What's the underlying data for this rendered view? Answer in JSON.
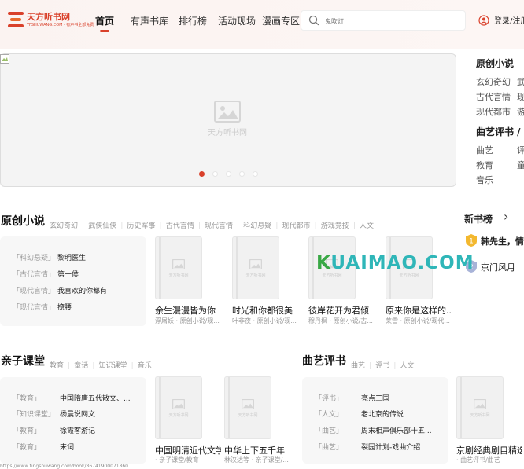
{
  "header": {
    "logo_text": "天方听书网",
    "logo_sub": "TFSHUWANG.COM · 有声书全部免费",
    "nav": [
      "首页",
      "有声书库",
      "排行榜",
      "活动现场",
      "漫画专区"
    ],
    "search_placeholder": "鬼吹灯",
    "login_label": "登录/注册"
  },
  "banner": {
    "placeholder_text": "天方听书网",
    "dots": 5,
    "active_dot": 0
  },
  "side_panel": {
    "title1": "原创小说",
    "row1": [
      "玄幻奇幻",
      "武"
    ],
    "row2": [
      "古代言情",
      "现"
    ],
    "row3": [
      "现代都市",
      "游"
    ],
    "title2": "曲艺评书 / 亲",
    "row4": [
      "曲艺",
      "评"
    ],
    "row5": [
      "教育",
      "童"
    ],
    "row6": [
      "音乐"
    ]
  },
  "original": {
    "title": "原创小说",
    "cats": [
      "玄幻奇幻",
      "武侠仙侠",
      "历史军事",
      "古代言情",
      "现代言情",
      "科幻悬疑",
      "现代都市",
      "游戏竞技",
      "人文"
    ],
    "list": [
      {
        "tag": "「科幻悬疑」",
        "name": "黎明医生"
      },
      {
        "tag": "「古代言情」",
        "name": "第一侯"
      },
      {
        "tag": "「现代言情」",
        "name": "我喜欢的你都有"
      },
      {
        "tag": "「现代言情」",
        "name": "撩腰"
      }
    ],
    "books": [
      {
        "title": "余生漫漫皆为你",
        "sub": "浮屠妖 · 原创小说/现..."
      },
      {
        "title": "时光和你都很美",
        "sub": "叶非夜 · 原创小说/现..."
      },
      {
        "title": "彼岸花开为君倾",
        "sub": "穆丹枫 · 原创小说/古..."
      },
      {
        "title": "原来你是这样的...",
        "sub": "莱雪 · 原创小说/现代..."
      }
    ]
  },
  "rank": {
    "title": "新书榜",
    "arrow": "›",
    "items": [
      {
        "num": "1",
        "name": "韩先生，情谊"
      },
      {
        "num": "2",
        "name": "京门风月"
      }
    ]
  },
  "watermark": "KUAIMAO.COM",
  "kids": {
    "title": "亲子课堂",
    "cats": [
      "教育",
      "童话",
      "知识课堂",
      "音乐"
    ],
    "list": [
      {
        "tag": "「教育」",
        "name": "中国隋唐五代散文、..."
      },
      {
        "tag": "「知识课堂」",
        "name": "杨晨说网文"
      },
      {
        "tag": "「教育」",
        "name": "徐霞客游记"
      },
      {
        "tag": "「教育」",
        "name": "宋词"
      }
    ],
    "books": [
      {
        "title": "中国明清近代文学",
        "sub": "· 亲子课堂/教育"
      },
      {
        "title": "中华上下五千年",
        "sub": "林汉达等 · 亲子课堂/..."
      }
    ]
  },
  "quyi": {
    "title": "曲艺评书",
    "cats": [
      "曲艺",
      "评书",
      "人文"
    ],
    "list": [
      {
        "tag": "「评书」",
        "name": "亮点三国"
      },
      {
        "tag": "「人文」",
        "name": "老北京的传说"
      },
      {
        "tag": "「曲艺」",
        "name": "周末相声俱乐部十五..."
      },
      {
        "tag": "「曲艺」",
        "name": "裂园计划-戏曲介绍"
      }
    ],
    "books": [
      {
        "title": "京剧经典剧目精选",
        "sub": "· 曲艺评书/曲艺"
      }
    ]
  },
  "cover_text": "天方听书网",
  "statusbar": "https://www.tingshuwang.com/book/86741900071860"
}
